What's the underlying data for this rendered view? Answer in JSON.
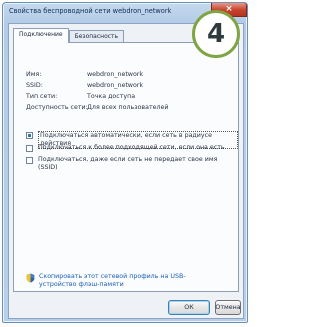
{
  "window": {
    "title": "Свойства беспроводной сети webdron_network",
    "close_symbol": "×"
  },
  "tabs": [
    {
      "label": "Подключение",
      "active": true
    },
    {
      "label": "Безопасность",
      "active": false
    }
  ],
  "badge": {
    "number": "4",
    "color": "#7fa443"
  },
  "properties": [
    {
      "label": "Имя:",
      "value": "webdron_network"
    },
    {
      "label": "SSID:",
      "value": "webdron_network"
    },
    {
      "label": "Тип сети:",
      "value": "Точка доступа"
    },
    {
      "label": "Доступность сети:",
      "value": "Для всех пользователей"
    }
  ],
  "options": [
    {
      "label": "Подключаться автоматически, если сеть в радиусе действия",
      "checked": true,
      "focused": true
    },
    {
      "label": "Подключаться к более подходящей сети, если она есть",
      "checked": false,
      "focused": false
    },
    {
      "label": "Подключаться, даже если сеть не передает свое имя (SSID)",
      "checked": false,
      "focused": false
    }
  ],
  "share_link": "Скопировать этот сетевой профиль на USB-устройство флэш-памяти",
  "buttons": {
    "ok": "ОК",
    "cancel": "Отмена"
  },
  "icons": {
    "close": "close-icon",
    "share": "shield-icon"
  }
}
